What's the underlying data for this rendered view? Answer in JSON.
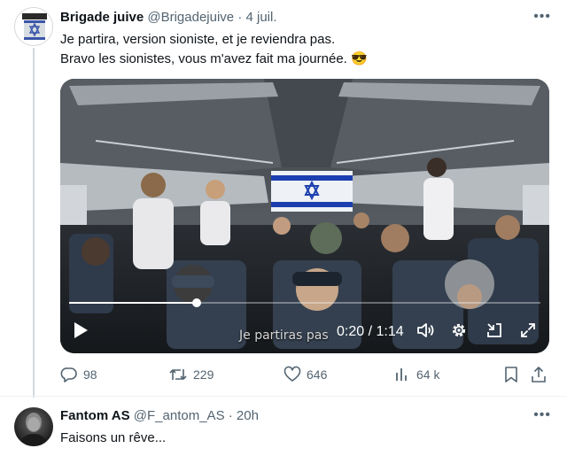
{
  "tweets": [
    {
      "display_name": "Brigade juive",
      "handle": "@Brigadejuive",
      "separator": "·",
      "time": "4 juil.",
      "more": "•••",
      "lines": [
        "Je partira, version sioniste, et je reviendra pas.",
        "Bravo les sionistes, vous m'avez fait ma journée. 😎"
      ],
      "video": {
        "subtitle": "Je partiras pas",
        "time_readout": "0:20 / 1:14",
        "progress_fraction": 0.27,
        "icons": [
          "play-icon",
          "volume-icon",
          "settings-gear-icon",
          "picture-in-picture-icon",
          "fullscreen-icon"
        ]
      },
      "actions": {
        "replies": "98",
        "retweets": "229",
        "likes": "646",
        "views": "64 k"
      },
      "avatar_icon": "star-of-david-banner-icon"
    },
    {
      "display_name": "Fantom AS",
      "handle": "@F_antom_AS",
      "separator": "·",
      "time": "20h",
      "more": "•••",
      "lines": [
        "Faisons un rêve..."
      ],
      "avatar_icon": "dark-portrait-avatar"
    }
  ],
  "colors": {
    "text_primary": "#0f1419",
    "text_secondary": "#536471",
    "divider": "#eff3f4",
    "thread_line": "#cfd9de",
    "flag_blue": "#1c3fb0"
  }
}
